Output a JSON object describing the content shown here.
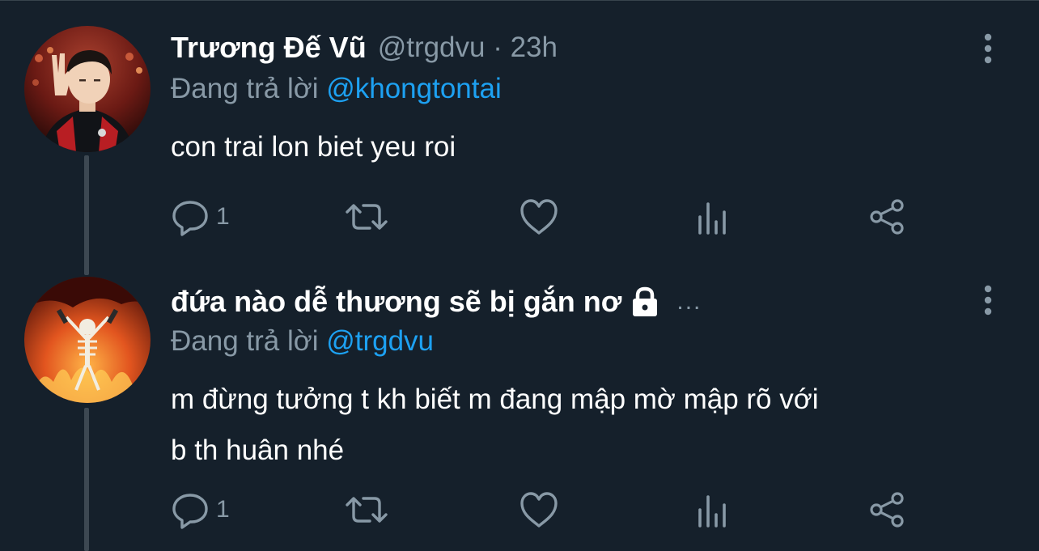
{
  "tweets": [
    {
      "display_name": "Trương Đế Vũ",
      "handle_time": "@trgdvu · 23h",
      "reply_prefix": "Đang trả lời ",
      "reply_mention": "@khongtontai",
      "text_lines": [
        "con trai lon biet yeu roi"
      ],
      "reply_count": "1",
      "locked": false,
      "truncated": false
    },
    {
      "display_name": "đứa nào dễ thương sẽ bị gắn nơ",
      "handle_time": "",
      "reply_prefix": "Đang trả lời ",
      "reply_mention": "@trgdvu",
      "text_lines": [
        "m đừng tưởng t kh biết m đang mập mờ mập rõ với",
        "b th huân nhé"
      ],
      "reply_count": "1",
      "locked": true,
      "truncated": true,
      "ellipsis": "..."
    }
  ],
  "icons": {
    "reply": "reply-bubble-icon",
    "retweet": "retweet-icon",
    "like": "heart-icon",
    "analytics": "analytics-icon",
    "share": "share-icon",
    "more": "more-vertical-icon",
    "lock": "lock-icon"
  },
  "colors": {
    "background": "#15202b",
    "text_primary": "#ffffff",
    "text_secondary": "#8899a6",
    "accent": "#1da1f2",
    "thread_line": "#3d4852"
  }
}
